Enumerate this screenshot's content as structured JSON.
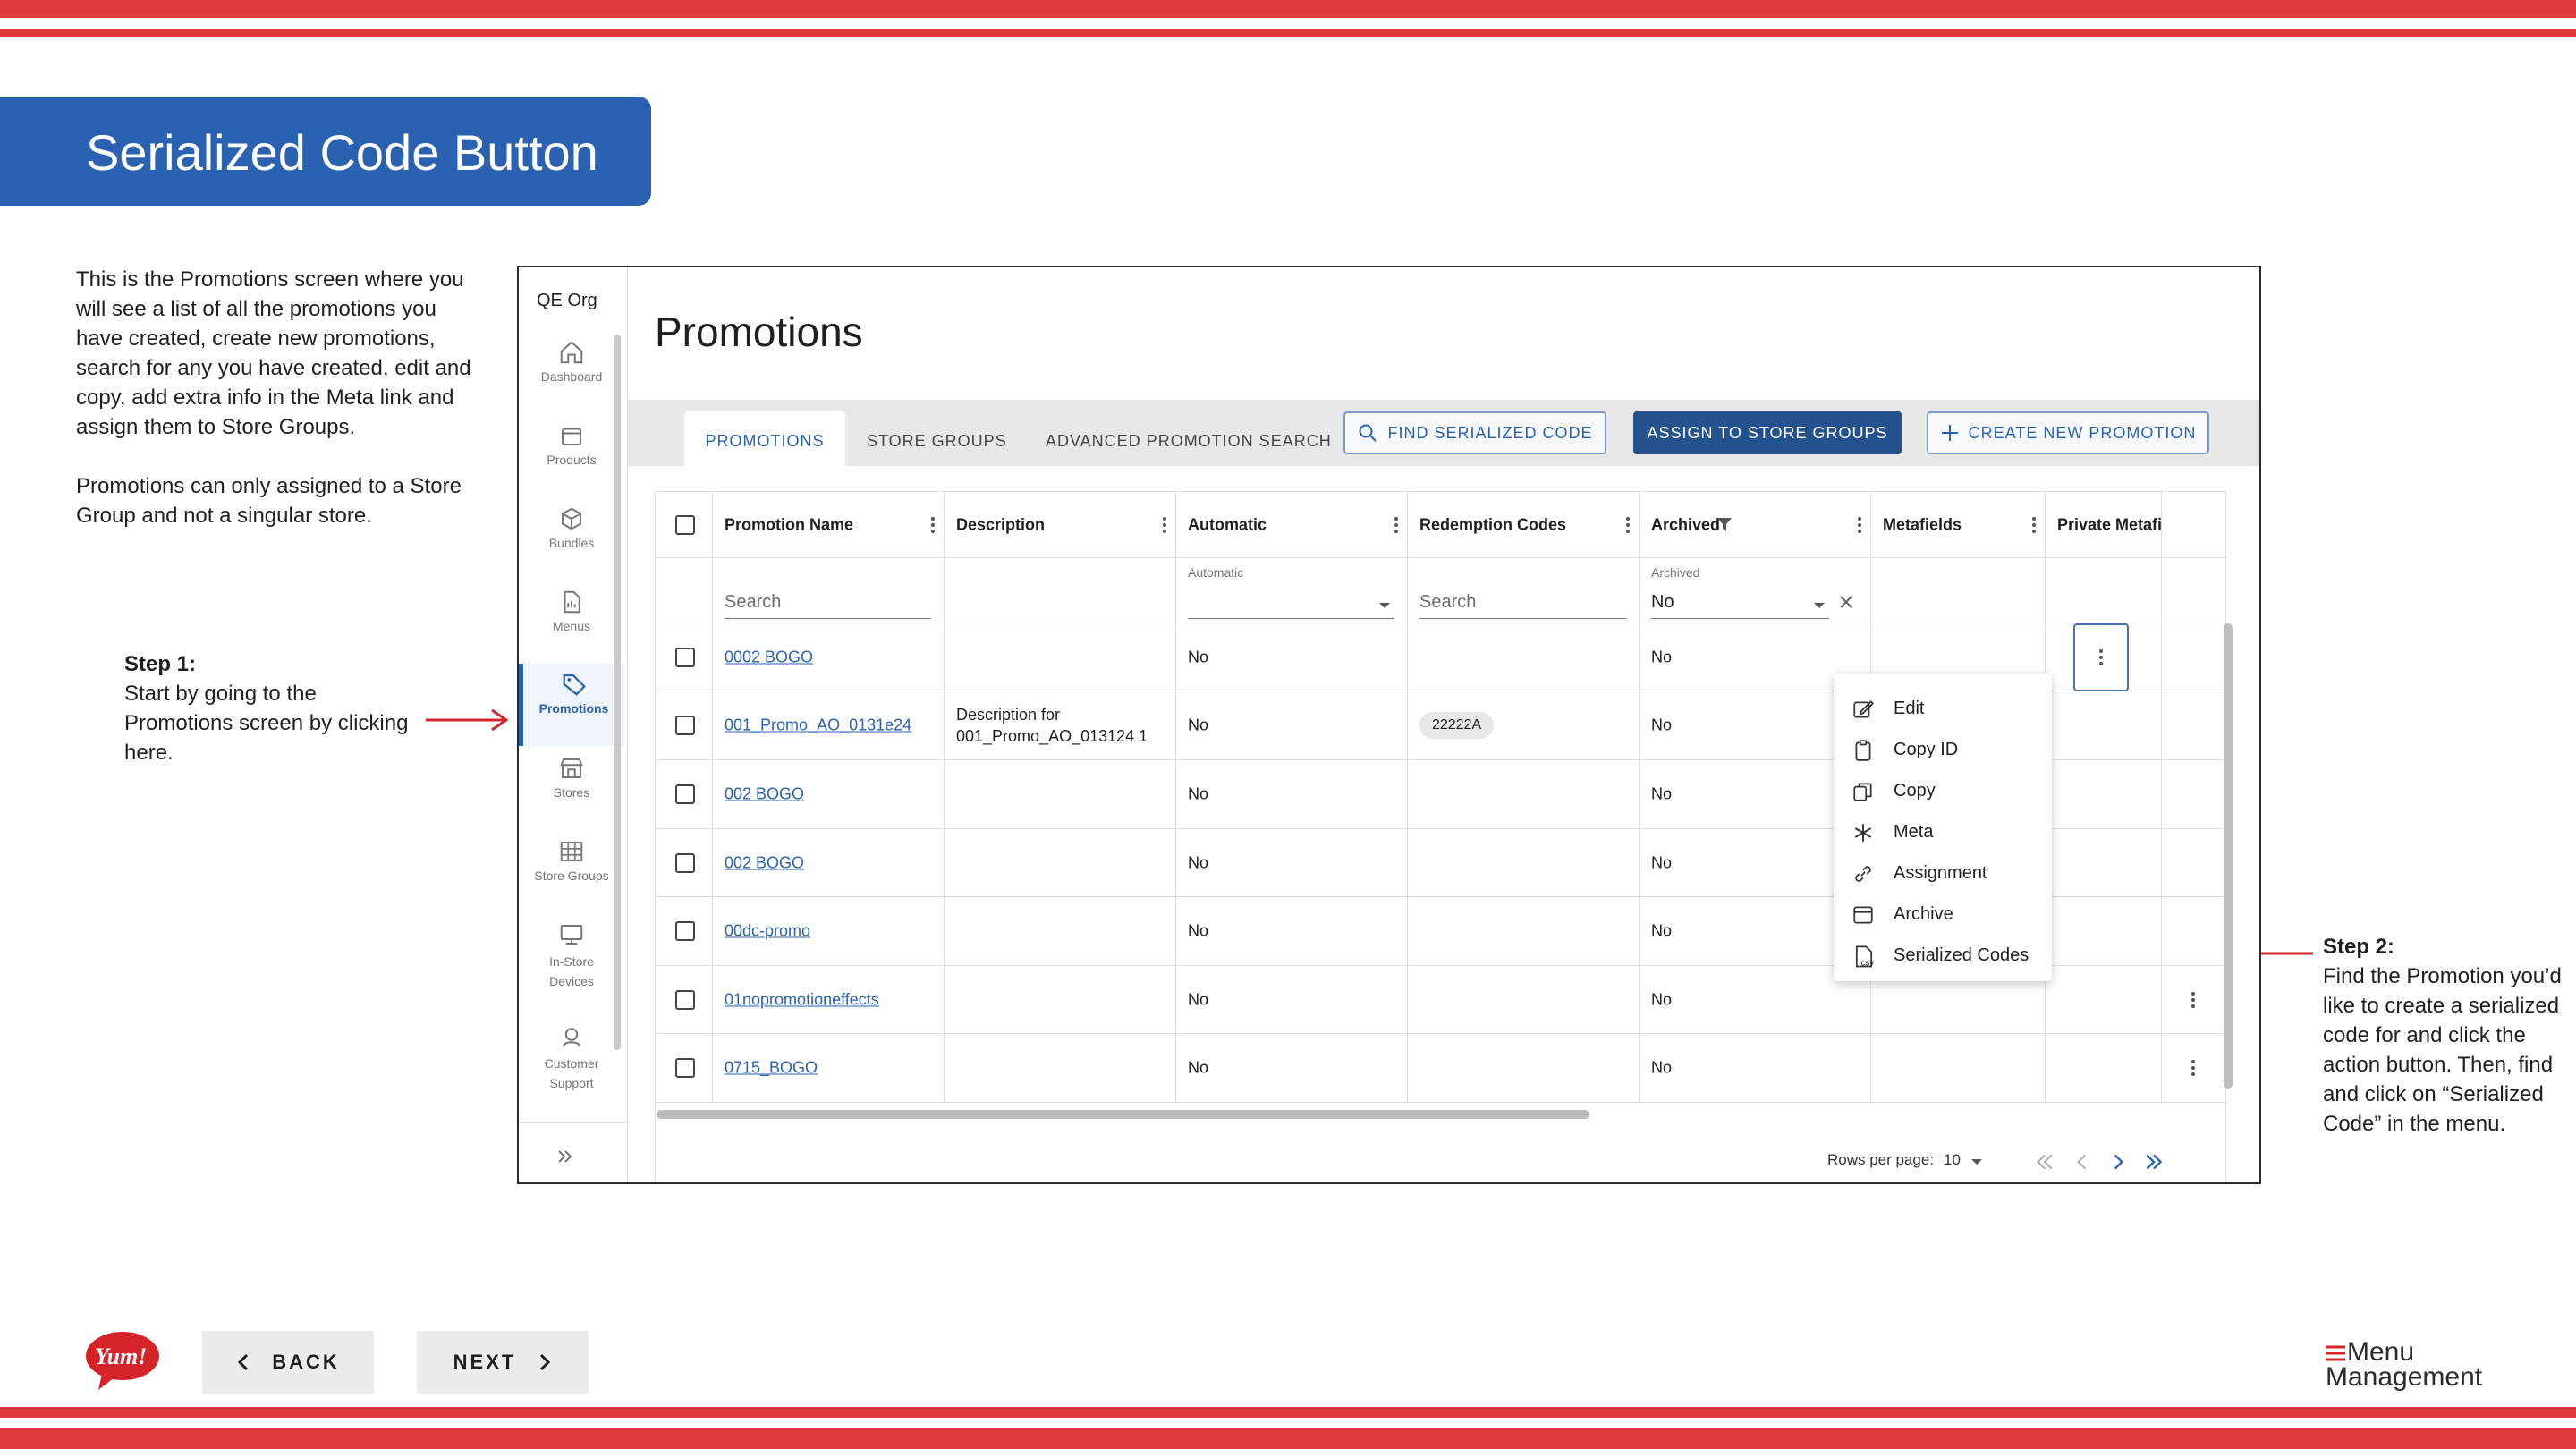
{
  "slide": {
    "title": "Serialized Code Button",
    "intro_p1": "This is the Promotions screen where you will see a list of all the promotions you have created, create new promotions, search for any you have created, edit and copy, add extra info in the Meta link and assign them to Store Groups.",
    "intro_p2": "Promotions can only assigned to a Store Group and not a singular store.",
    "step1_title": "Step 1:",
    "step1_text": "Start by going to the Promotions screen by clicking here.",
    "step2_title": "Step 2:",
    "step2_text": "Find the Promotion you’d like to create a serialized code for and click the action button. Then, find and click on “Serialized Code” in the menu.",
    "back_label": "BACK",
    "next_label": "NEXT",
    "brand_logo": "Yum!",
    "product_logo_line1": "Menu",
    "product_logo_line2": "Management",
    "accent_color": "#e03a3e",
    "banner_color": "#2a61b0"
  },
  "app": {
    "org": "QE Org",
    "sidebar": [
      {
        "label": "Dashboard",
        "icon": "home-icon"
      },
      {
        "label": "Products",
        "icon": "box-icon"
      },
      {
        "label": "Bundles",
        "icon": "cube-icon"
      },
      {
        "label": "Menus",
        "icon": "document-icon"
      },
      {
        "label": "Promotions",
        "icon": "tag-icon"
      },
      {
        "label": "Stores",
        "icon": "storefront-icon"
      },
      {
        "label": "Store Groups",
        "icon": "grid-icon"
      },
      {
        "label": "In-Store Devices",
        "icon": "monitor-icon"
      },
      {
        "label": "Customer Support",
        "icon": "headset-icon"
      }
    ],
    "page_title": "Promotions",
    "tabs": [
      "PROMOTIONS",
      "STORE GROUPS",
      "ADVANCED PROMOTION SEARCH"
    ],
    "buttons": {
      "find": "FIND SERIALIZED CODE",
      "assign": "ASSIGN TO STORE GROUPS",
      "create": "CREATE NEW PROMOTION"
    },
    "columns": [
      "Promotion Name",
      "Description",
      "Automatic",
      "Redemption Codes",
      "Archived",
      "Metafields",
      "Private Metafi"
    ],
    "filters": {
      "name_placeholder": "Search",
      "automatic_label": "Automatic",
      "codes_placeholder": "Search",
      "archived_label": "Archived",
      "archived_value": "No"
    },
    "rows": [
      {
        "name": "0002 BOGO",
        "description": "",
        "automatic": "No",
        "codes": "",
        "archived": "No"
      },
      {
        "name": "001_Promo_AO_0131e24",
        "description": "Description for 001_Promo_AO_013124 1",
        "automatic": "No",
        "codes": "22222A",
        "archived": "No"
      },
      {
        "name": "002 BOGO",
        "description": "",
        "automatic": "No",
        "codes": "",
        "archived": "No"
      },
      {
        "name": "002 BOGO",
        "description": "",
        "automatic": "No",
        "codes": "",
        "archived": "No"
      },
      {
        "name": "00dc-promo",
        "description": "",
        "automatic": "No",
        "codes": "",
        "archived": "No"
      },
      {
        "name": "01nopromotioneffects",
        "description": "",
        "automatic": "No",
        "codes": "",
        "archived": "No"
      },
      {
        "name": "0715_BOGO",
        "description": "",
        "automatic": "No",
        "codes": "",
        "archived": "No"
      }
    ],
    "menu": [
      "Edit",
      "Copy ID",
      "Copy",
      "Meta",
      "Assignment",
      "Archive",
      "Serialized Codes"
    ],
    "pagination": {
      "rows_per_page_label": "Rows per page:",
      "rows_per_page_value": "10"
    }
  }
}
